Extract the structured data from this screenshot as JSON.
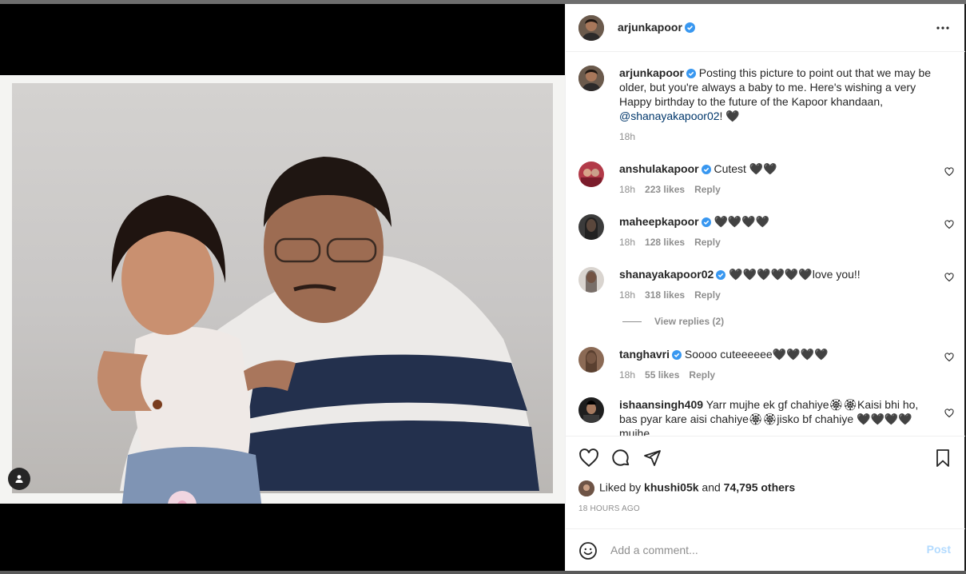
{
  "post": {
    "author": "arjunkapoor",
    "more_icon": "more-horizontal-icon",
    "caption_text": "Posting this picture to point out that we may be older, but you're always a baby to me. Here's wishing a very Happy birthday to the future of the Kapoor khandaan,",
    "caption_mention": "@shanayakapoor02",
    "caption_tail": "! 🖤",
    "caption_time": "18h"
  },
  "comments": [
    {
      "user": "anshulakapoor",
      "text": "Cutest 🖤🖤",
      "time": "18h",
      "likes": "223 likes",
      "reply": "Reply"
    },
    {
      "user": "maheepkapoor",
      "text": "🖤🖤🖤🖤",
      "time": "18h",
      "likes": "128 likes",
      "reply": "Reply"
    },
    {
      "user": "shanayakapoor02",
      "text": "🖤🖤🖤🖤🖤🖤love you!!",
      "time": "18h",
      "likes": "318 likes",
      "reply": "Reply",
      "view_replies": "View replies (2)"
    },
    {
      "user": "tanghavri",
      "text": "Soooo cuteeeeee🖤🖤🖤🖤",
      "time": "18h",
      "likes": "55 likes",
      "reply": "Reply"
    },
    {
      "user": "ishaansingh409",
      "text": "Yarr mujhe ek gf chahiye🏵🏵Kaisi bhi ho, bas pyar kare aisi chahiye🏵🏵jisko bf chahiye 🖤🖤🖤🖤 mujhe"
    }
  ],
  "liked_by": {
    "prefix": "Liked by",
    "user": "khushi05k",
    "and": "and",
    "others": "74,795 others"
  },
  "time_ago": "18 HOURS AGO",
  "add_comment": {
    "placeholder": "Add a comment...",
    "post_label": "Post"
  },
  "colors": {
    "verified": "#3897f0",
    "link": "#00376b",
    "post_disabled": "#b3dbff"
  }
}
